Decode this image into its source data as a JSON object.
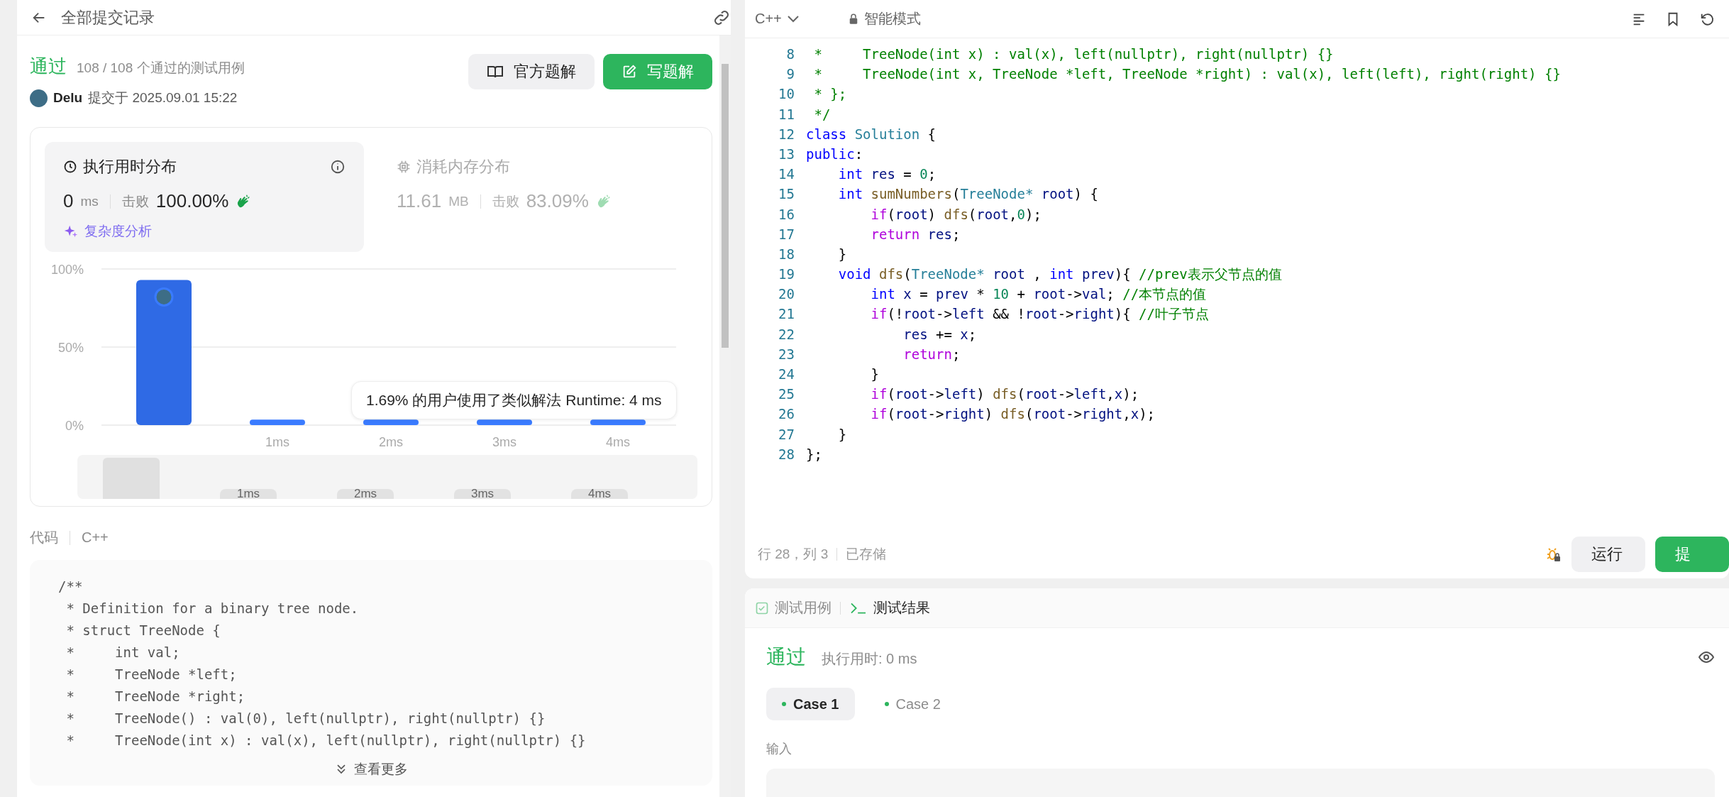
{
  "header": {
    "title": "全部提交记录"
  },
  "submission": {
    "status": "通过",
    "cases": "108 / 108 个通过的测试用例",
    "user": "Delu",
    "submitted": "提交于 2025.09.01 15:22",
    "buttons": [
      {
        "label": "官方题解",
        "kind": "secondary"
      },
      {
        "label": "写题解",
        "kind": "primary"
      }
    ]
  },
  "stats": [
    {
      "title": "执行用时分布",
      "value": "0",
      "unit": "ms",
      "beats_label": "击败",
      "beats": "100.00%",
      "selected": true
    },
    {
      "title": "消耗内存分布",
      "value": "11.61",
      "unit": "MB",
      "beats_label": "击败",
      "beats": "83.09%",
      "selected": false
    }
  ],
  "analysis_link": "复杂度分析",
  "chart": {
    "chart_data": {
      "type": "bar",
      "categories": [
        null,
        "1ms",
        "2ms",
        "3ms",
        "4ms"
      ],
      "values": [
        93,
        3.5,
        3.5,
        3.5,
        3.5
      ],
      "ylim": [
        0,
        100
      ],
      "yticks": [
        {
          "value": 0,
          "label": "0%"
        },
        {
          "value": 50,
          "label": "50%"
        },
        {
          "value": 100,
          "label": "100%"
        }
      ]
    },
    "tooltip": "1.69% 的用户使用了类似解法 Runtime: 4 ms",
    "overview_labels": [
      "1ms",
      "2ms",
      "3ms",
      "4ms"
    ]
  },
  "code_section": {
    "label": "代码",
    "language": "C++",
    "more": "查看更多",
    "lines": [
      "/**",
      " * Definition for a binary tree node.",
      " * struct TreeNode {",
      " *     int val;",
      " *     TreeNode *left;",
      " *     TreeNode *right;",
      " *     TreeNode() : val(0), left(nullptr), right(nullptr) {}",
      " *     TreeNode(int x) : val(x), left(nullptr), right(nullptr) {}"
    ]
  },
  "editor": {
    "language": "C++",
    "mode": "智能模式",
    "status": "行 28，列 3",
    "saved": "已存储",
    "buttons": [
      {
        "label": "运行",
        "kind": "secondary"
      },
      {
        "label": "提",
        "kind": "primary"
      }
    ],
    "lines": [
      {
        "n": "8",
        "tokens": [
          {
            "kind": "comment",
            "text": " *     TreeNode(int x) : val(x), left(nullptr), right(nullptr) {}"
          }
        ]
      },
      {
        "n": "9",
        "tokens": [
          {
            "kind": "comment",
            "text": " *     TreeNode(int x, TreeNode *left, TreeNode *right) : val(x), left(left), right(right) {}"
          }
        ]
      },
      {
        "n": "10",
        "tokens": [
          {
            "kind": "comment",
            "text": " * };"
          }
        ]
      },
      {
        "n": "11",
        "tokens": [
          {
            "kind": "comment",
            "text": " */"
          }
        ]
      },
      {
        "n": "12",
        "tokens": [
          {
            "kind": "keyword",
            "text": "class "
          },
          {
            "kind": "type",
            "text": "Solution"
          },
          {
            "kind": "plain",
            "text": " {"
          }
        ]
      },
      {
        "n": "13",
        "tokens": [
          {
            "kind": "keyword",
            "text": "public"
          },
          {
            "kind": "plain",
            "text": ":"
          }
        ]
      },
      {
        "n": "14",
        "tokens": [
          {
            "kind": "keyword",
            "text": "    int"
          },
          {
            "kind": "variable",
            "text": " res"
          },
          {
            "kind": "plain",
            "text": " = "
          },
          {
            "kind": "number",
            "text": "0"
          },
          {
            "kind": "plain",
            "text": ";"
          }
        ]
      },
      {
        "n": "15",
        "tokens": [
          {
            "kind": "keyword",
            "text": "    int"
          },
          {
            "kind": "function",
            "text": " sumNumbers"
          },
          {
            "kind": "plain",
            "text": "("
          },
          {
            "kind": "type",
            "text": "TreeNode*"
          },
          {
            "kind": "variable",
            "text": " root"
          },
          {
            "kind": "plain",
            "text": ") {"
          }
        ]
      },
      {
        "n": "16",
        "tokens": [
          {
            "kind": "control",
            "text": "        if"
          },
          {
            "kind": "plain",
            "text": "("
          },
          {
            "kind": "variable",
            "text": "root"
          },
          {
            "kind": "plain",
            "text": ") "
          },
          {
            "kind": "function",
            "text": "dfs"
          },
          {
            "kind": "plain",
            "text": "("
          },
          {
            "kind": "variable",
            "text": "root"
          },
          {
            "kind": "plain",
            "text": ","
          },
          {
            "kind": "number",
            "text": "0"
          },
          {
            "kind": "plain",
            "text": ");"
          }
        ]
      },
      {
        "n": "17",
        "tokens": [
          {
            "kind": "control",
            "text": "        return"
          },
          {
            "kind": "variable",
            "text": " res"
          },
          {
            "kind": "plain",
            "text": ";"
          }
        ]
      },
      {
        "n": "18",
        "tokens": [
          {
            "kind": "plain",
            "text": "    }"
          }
        ]
      },
      {
        "n": "19",
        "tokens": [
          {
            "kind": "keyword",
            "text": "    void"
          },
          {
            "kind": "function",
            "text": " dfs"
          },
          {
            "kind": "plain",
            "text": "("
          },
          {
            "kind": "type",
            "text": "TreeNode*"
          },
          {
            "kind": "variable",
            "text": " root"
          },
          {
            "kind": "plain",
            "text": " , "
          },
          {
            "kind": "keyword",
            "text": "int"
          },
          {
            "kind": "variable",
            "text": " prev"
          },
          {
            "kind": "plain",
            "text": "){ "
          },
          {
            "kind": "comment",
            "text": "//prev表示父节点的值"
          }
        ]
      },
      {
        "n": "20",
        "tokens": [
          {
            "kind": "keyword",
            "text": "        int"
          },
          {
            "kind": "variable",
            "text": " x"
          },
          {
            "kind": "plain",
            "text": " = "
          },
          {
            "kind": "variable",
            "text": "prev"
          },
          {
            "kind": "plain",
            "text": " * "
          },
          {
            "kind": "number",
            "text": "10"
          },
          {
            "kind": "plain",
            "text": " + "
          },
          {
            "kind": "variable",
            "text": "root"
          },
          {
            "kind": "plain",
            "text": "->"
          },
          {
            "kind": "variable",
            "text": "val"
          },
          {
            "kind": "plain",
            "text": "; "
          },
          {
            "kind": "comment",
            "text": "//本节点的值"
          }
        ]
      },
      {
        "n": "21",
        "tokens": [
          {
            "kind": "control",
            "text": "        if"
          },
          {
            "kind": "plain",
            "text": "(!"
          },
          {
            "kind": "variable",
            "text": "root"
          },
          {
            "kind": "plain",
            "text": "->"
          },
          {
            "kind": "variable",
            "text": "left"
          },
          {
            "kind": "plain",
            "text": " && !"
          },
          {
            "kind": "variable",
            "text": "root"
          },
          {
            "kind": "plain",
            "text": "->"
          },
          {
            "kind": "variable",
            "text": "right"
          },
          {
            "kind": "plain",
            "text": "){ "
          },
          {
            "kind": "comment",
            "text": "//叶子节点"
          }
        ]
      },
      {
        "n": "22",
        "tokens": [
          {
            "kind": "variable",
            "text": "            res"
          },
          {
            "kind": "plain",
            "text": " += "
          },
          {
            "kind": "variable",
            "text": "x"
          },
          {
            "kind": "plain",
            "text": ";"
          }
        ]
      },
      {
        "n": "23",
        "tokens": [
          {
            "kind": "control",
            "text": "            return"
          },
          {
            "kind": "plain",
            "text": ";"
          }
        ]
      },
      {
        "n": "24",
        "tokens": [
          {
            "kind": "plain",
            "text": "        }"
          }
        ]
      },
      {
        "n": "25",
        "tokens": [
          {
            "kind": "control",
            "text": "        if"
          },
          {
            "kind": "plain",
            "text": "("
          },
          {
            "kind": "variable",
            "text": "root"
          },
          {
            "kind": "plain",
            "text": "->"
          },
          {
            "kind": "variable",
            "text": "left"
          },
          {
            "kind": "plain",
            "text": ") "
          },
          {
            "kind": "function",
            "text": "dfs"
          },
          {
            "kind": "plain",
            "text": "("
          },
          {
            "kind": "variable",
            "text": "root"
          },
          {
            "kind": "plain",
            "text": "->"
          },
          {
            "kind": "variable",
            "text": "left"
          },
          {
            "kind": "plain",
            "text": ","
          },
          {
            "kind": "variable",
            "text": "x"
          },
          {
            "kind": "plain",
            "text": ");"
          }
        ]
      },
      {
        "n": "26",
        "tokens": [
          {
            "kind": "control",
            "text": "        if"
          },
          {
            "kind": "plain",
            "text": "("
          },
          {
            "kind": "variable",
            "text": "root"
          },
          {
            "kind": "plain",
            "text": "->"
          },
          {
            "kind": "variable",
            "text": "right"
          },
          {
            "kind": "plain",
            "text": ") "
          },
          {
            "kind": "function",
            "text": "dfs"
          },
          {
            "kind": "plain",
            "text": "("
          },
          {
            "kind": "variable",
            "text": "root"
          },
          {
            "kind": "plain",
            "text": "->"
          },
          {
            "kind": "variable",
            "text": "right"
          },
          {
            "kind": "plain",
            "text": ","
          },
          {
            "kind": "variable",
            "text": "x"
          },
          {
            "kind": "plain",
            "text": ");"
          }
        ]
      },
      {
        "n": "27",
        "tokens": [
          {
            "kind": "plain",
            "text": "    }"
          }
        ]
      },
      {
        "n": "28",
        "tokens": [
          {
            "kind": "plain",
            "text": "};"
          }
        ]
      }
    ]
  },
  "result": {
    "tabs": [
      {
        "label": "测试用例",
        "kind": "cases",
        "selected": false
      },
      {
        "label": "测试结果",
        "kind": "console",
        "selected": true
      }
    ],
    "status": "通过",
    "runtime": "执行用时: 0 ms",
    "cases": [
      {
        "label": "Case 1",
        "selected": true
      },
      {
        "label": "Case 2",
        "selected": false
      }
    ],
    "input_label": "输入"
  }
}
